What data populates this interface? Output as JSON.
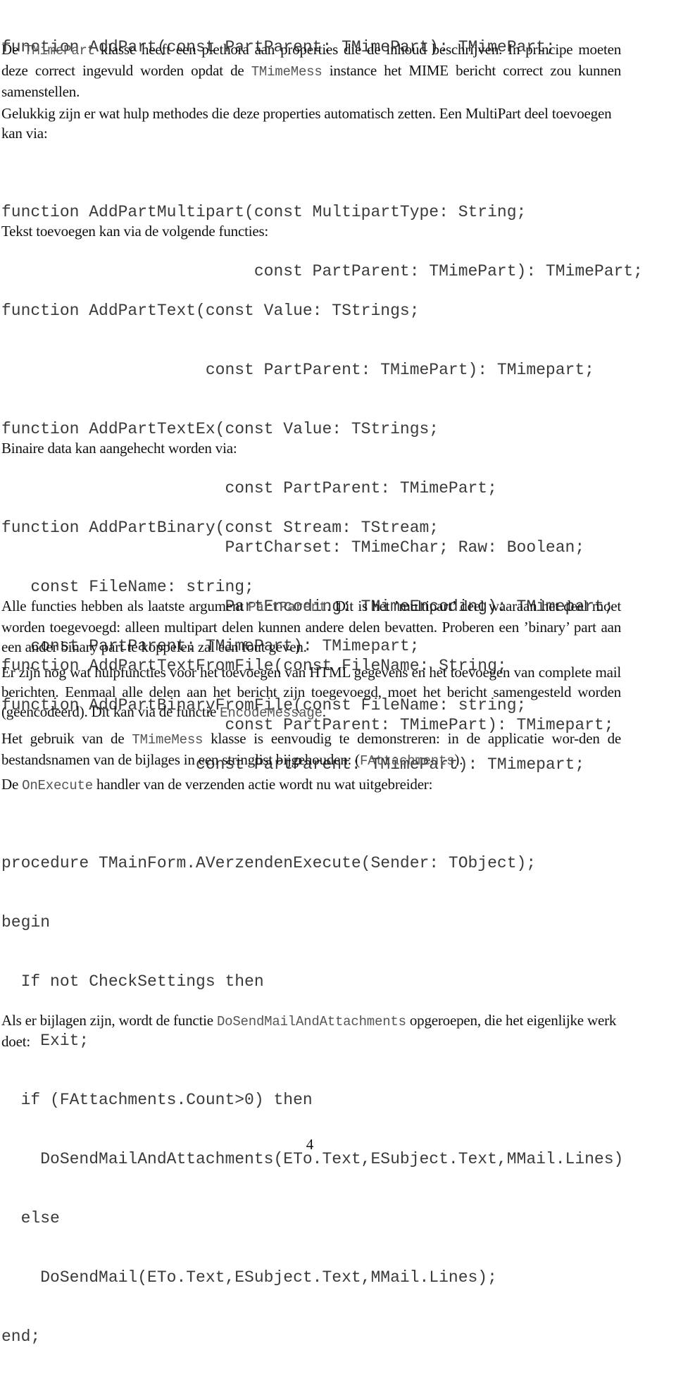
{
  "code_blocks": {
    "addpart": [
      "function AddPart(const PartParent: TMimePart): TMimePart;"
    ],
    "multipart": [
      "function AddPartMultipart(const MultipartType: String;",
      "                          const PartParent: TMimePart): TMimePart;"
    ],
    "text_functions": [
      "function AddPartText(const Value: TStrings;",
      "                     const PartParent: TMimePart): TMimepart;",
      "function AddPartTextEx(const Value: TStrings;",
      "                       const PartParent: TMimePart;",
      "                       PartCharset: TMimeChar; Raw: Boolean;",
      "                       PartEncoding: TMimeEncoding): TMimepart;",
      "function AddPartTextFromFile(const FileName: String;",
      "                       const PartParent: TMimePart): TMimepart;"
    ],
    "binary_functions": [
      "function AddPartBinary(const Stream: TStream;",
      "   const FileName: string;",
      "   const PartParent: TMimePart): TMimepart;",
      "function AddPartBinaryFromFile(const FileName: string;",
      "                    const PartParent: TMimePart): TMimepart;"
    ],
    "execute_handler": [
      "procedure TMainForm.AVerzendenExecute(Sender: TObject);",
      "begin",
      "  If not CheckSettings then",
      "    Exit;",
      "  if (FAttachments.Count>0) then",
      "    DoSendMailAndAttachments(ETo.Text,ESubject.Text,MMail.Lines)",
      "  else",
      "    DoSendMail(ETo.Text,ESubject.Text,MMail.Lines);",
      "end;"
    ]
  },
  "paragraphs": {
    "p1": {
      "a": "De ",
      "code1": "TMimePart",
      "b": " klasse heeft een plethora aan properties die de inhoud beschrijven.  In principe moeten deze correct ingevuld worden opdat de ",
      "code2": "TMimeMess",
      "c": " instance het MIME bericht correct zou kunnen samenstellen."
    },
    "p2": "Gelukkig zijn er wat hulp methodes die deze properties automatisch zetten. Een MultiPart deel toevoegen kan via:",
    "p3": "Tekst toevoegen kan via de volgende functies:",
    "p4": "Binaire data kan aangehecht worden via:",
    "p5": {
      "a": "Alle functies hebben als laatste argument ",
      "code1": "PartParent",
      "b": ". Dit is het ’multipart’ deel waaraan het deel moet worden toegevoegd:  alleen multipart delen kunnen andere delen bevatten. Proberen een ’binary’ part aan een ander binary part te koppelen zal een fout geven."
    },
    "p6": {
      "a": "Er zijn nog wat hulpfuncties voor het toevoegen van HTML gegevens en het toevoegen van complete mail berichten. Eenmaal alle delen aan het bericht zijn toegevoegd, moet het bericht samengesteld worden (geencodeerd). Dit kan via de functie ",
      "code1": "EncodeMessage",
      "b": "."
    },
    "p7": {
      "a": "Het gebruik van de ",
      "code1": "TMimeMess",
      "b": " klasse is eenvoudig te demonstreren: in de applicatie wor-den de bestandsnamen van de bijlages in een stringlist bijgehouden: (",
      "code2": "FAttachments",
      "c": ")."
    },
    "p8": {
      "a": "De ",
      "code1": "OnExecute",
      "b": " handler van de verzenden actie wordt nu wat uitgebreider:"
    },
    "p9": {
      "a": "Als er bijlagen zijn, wordt de functie ",
      "code1": "DoSendMailAndAttachments",
      "b": " opgeroepen, die het eigenlijke werk doet:"
    }
  },
  "footer": {
    "page_number": "4"
  }
}
